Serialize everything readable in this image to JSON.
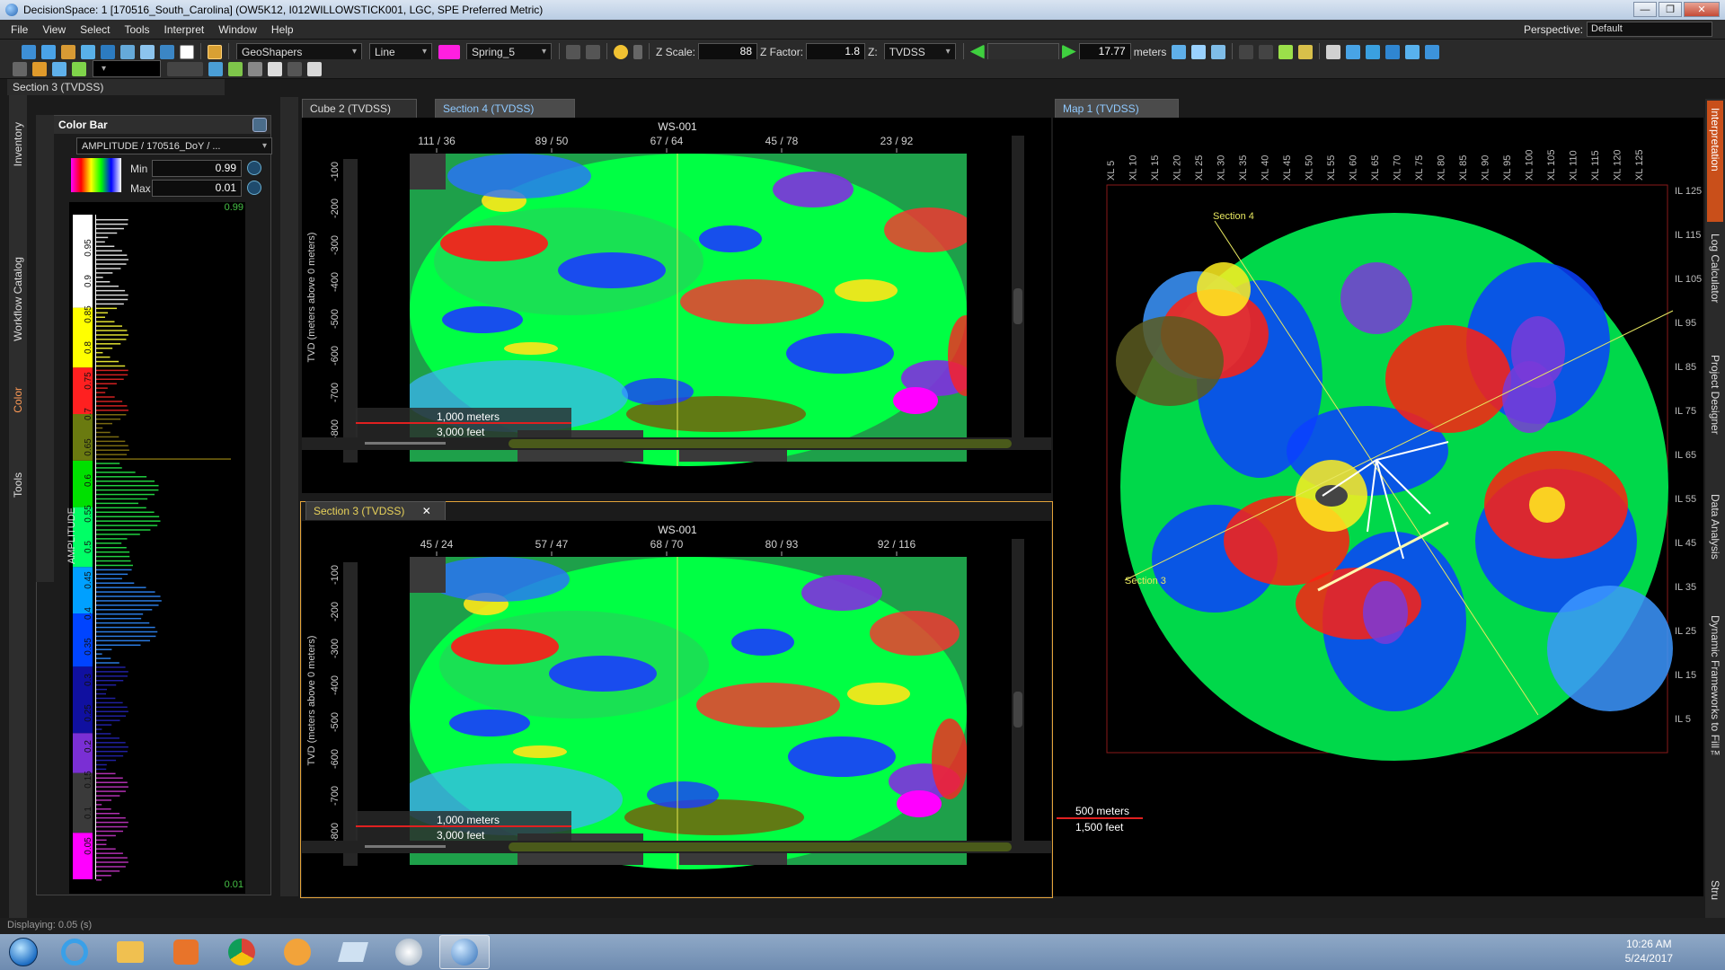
{
  "window": {
    "title": "DecisionSpace: 1 [170516_South_Carolina] (OW5K12, I012WILLOWSTICK001, LGC, SPE Preferred Metric)",
    "min": "—",
    "max": "❐",
    "close": "✕"
  },
  "menu": [
    "File",
    "View",
    "Select",
    "Tools",
    "Interpret",
    "Window",
    "Help"
  ],
  "perspective": {
    "label": "Perspective:",
    "value": "Default"
  },
  "toolbar": {
    "shaper": "GeoShapers",
    "mode": "Line",
    "colormap": "Spring_5",
    "zscale_label": "Z Scale:",
    "zscale": "88",
    "zfactor_label": "Z Factor:",
    "zfactor": "1.8",
    "zdomain_label": "Z:",
    "zdomain": "TVDSS",
    "depth": "17.77",
    "depth_unit": "meters"
  },
  "left_panel": {
    "title": "Section 3 (TVDSS)",
    "colorbar_title": "Color Bar",
    "attribute": "AMPLITUDE / 170516_DoY / ...",
    "min_label": "Min",
    "min_value": "0.99",
    "max_label": "Max",
    "max_value": "0.01",
    "axis_label": "AMPLITUDE",
    "top_value": "0.99",
    "bottom_value": "0.01",
    "ticks": [
      "0.95",
      "0.9",
      "0.85",
      "0.8",
      "0.75",
      "0.7",
      "0.65",
      "0.6",
      "0.55",
      "0.5",
      "0.45",
      "0.4",
      "0.35",
      "0.3",
      "0.25",
      "0.2",
      "0.15",
      "0.1",
      "0.05"
    ],
    "side_tabs": [
      "Inventory",
      "Workflow Catalog",
      "Color",
      "Tools"
    ]
  },
  "views": {
    "top": {
      "tabs": [
        "Cube 2 (TVDSS)",
        "Section 4 (TVDSS)"
      ],
      "well": "WS-001",
      "xticks": [
        "111 / 36",
        "89 / 50",
        "67 / 64",
        "45 / 78",
        "23 / 92"
      ],
      "yaxis": "TVD (meters above 0 meters)",
      "yticks": [
        "-100",
        "-200",
        "-300",
        "-400",
        "-500",
        "-600",
        "-700",
        "-800"
      ],
      "scale_m": "1,000 meters",
      "scale_ft": "3,000 feet"
    },
    "bottom": {
      "tab": "Section 3 (TVDSS)",
      "close": "✕",
      "well": "WS-001",
      "xticks": [
        "45 / 24",
        "57 / 47",
        "68 / 70",
        "80 / 93",
        "92 / 116"
      ],
      "yaxis": "TVD (meters above 0 meters)",
      "yticks": [
        "-100",
        "-200",
        "-300",
        "-400",
        "-500",
        "-600",
        "-700",
        "-800"
      ],
      "scale_m": "1,000 meters",
      "scale_ft": "3,000 feet"
    },
    "map": {
      "tab": "Map 1 (TVDSS)",
      "xl": [
        "XL 5",
        "XL 10",
        "XL 15",
        "XL 20",
        "XL 25",
        "XL 30",
        "XL 35",
        "XL 40",
        "XL 45",
        "XL 50",
        "XL 55",
        "XL 60",
        "XL 65",
        "XL 70",
        "XL 75",
        "XL 80",
        "XL 85",
        "XL 90",
        "XL 95",
        "XL 100",
        "XL 105",
        "XL 110",
        "XL 115",
        "XL 120",
        "XL 125"
      ],
      "il": [
        "IL 125",
        "IL 115",
        "IL 105",
        "IL 95",
        "IL 85",
        "IL 75",
        "IL 65",
        "IL 55",
        "IL 45",
        "IL 35",
        "IL 25",
        "IL 15",
        "IL 5"
      ],
      "section4": "Section 4",
      "section3": "Section 3",
      "scale_m": "500 meters",
      "scale_ft": "1,500 feet"
    }
  },
  "right_tabs": [
    "Interpretation",
    "Log Calculator",
    "Project Designer",
    "Data Analysis",
    "Dynamic Frameworks to Fill™",
    "Stru"
  ],
  "status": "Displaying: 0.05 (s)",
  "clock": {
    "time": "10:26 AM",
    "date": "5/24/2017"
  }
}
